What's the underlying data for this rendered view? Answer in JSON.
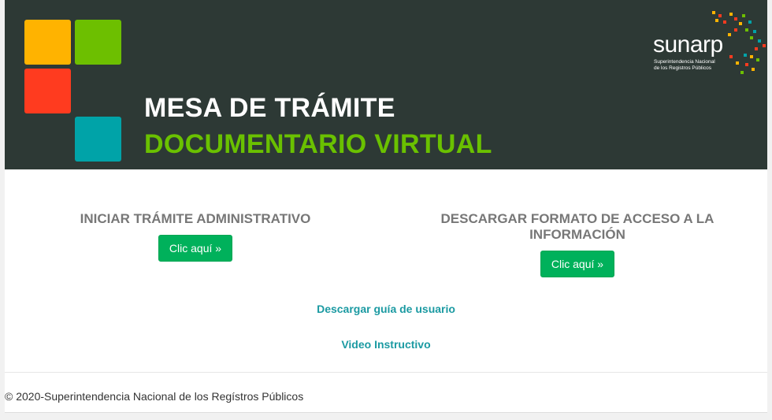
{
  "header": {
    "title_line1": "MESA DE TRÁMITE",
    "title_line2": "DOCUMENTARIO VIRTUAL",
    "title_line2_color": "#6ac100",
    "tiles": {
      "yellow": "#ffb300",
      "green": "#6dbf00",
      "red": "#ff3b1f",
      "teal": "#00a3a8"
    },
    "logo": {
      "word": "sunarp",
      "subtitle_line1": "Superintendencia Nacional",
      "subtitle_line2": "de los Registros Públicos"
    }
  },
  "main": {
    "left": {
      "heading": "INICIAR TRÁMITE ADMINISTRATIVO",
      "button_label": "Clic aquí »"
    },
    "right": {
      "heading_line1": "DESCARGAR FORMATO DE ACCESO A LA",
      "heading_line2": "INFORMACIÓN",
      "button_label": "Clic aquí »"
    },
    "link_guide": "Descargar guía de usuario",
    "link_video": "Video Instructivo"
  },
  "footer": {
    "copyright": "© 2020-Superintendencia Nacional de los Regístros Públicos"
  }
}
